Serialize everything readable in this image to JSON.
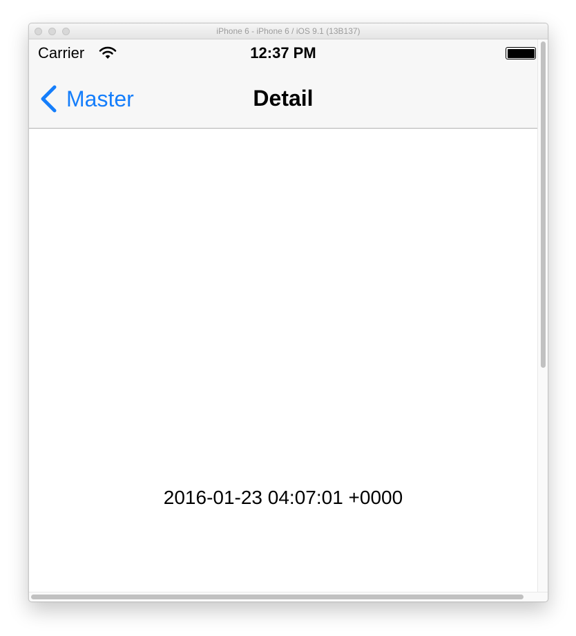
{
  "window": {
    "title": "iPhone 6 - iPhone 6 / iOS 9.1 (13B137)"
  },
  "status_bar": {
    "carrier": "Carrier",
    "wifi_icon": "wifi-icon",
    "time": "12:37 PM",
    "battery_icon": "battery-full-icon",
    "battery_level": 1.0
  },
  "nav_bar": {
    "back_icon": "chevron-left-icon",
    "back_label": "Master",
    "title": "Detail"
  },
  "detail": {
    "date_text": "2016-01-23 04:07:01 +0000"
  },
  "colors": {
    "tint": "#157efb",
    "nav_background": "#f7f7f7",
    "nav_border": "#b2b2b2"
  }
}
